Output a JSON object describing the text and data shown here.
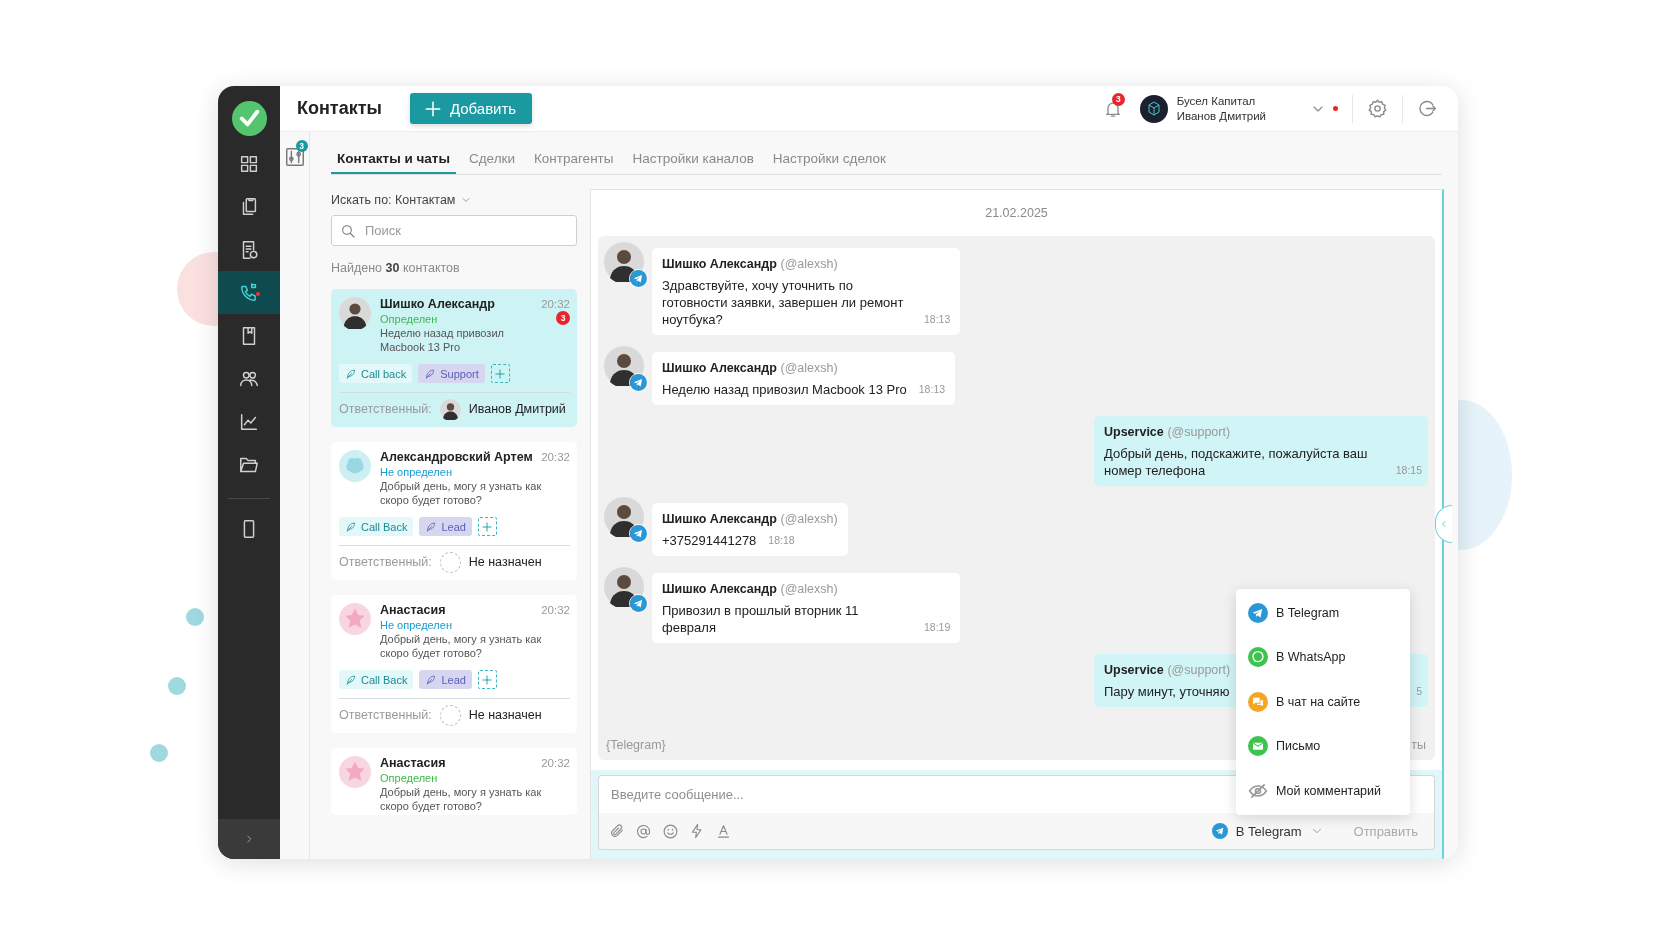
{
  "sidebar": {
    "main_items": [
      {
        "kind": "grid",
        "selected": false,
        "alert": false
      },
      {
        "kind": "copies",
        "selected": false,
        "alert": false
      },
      {
        "kind": "document",
        "selected": false,
        "alert": false
      },
      {
        "kind": "phone",
        "selected": true,
        "alert": true
      },
      {
        "kind": "book",
        "selected": false,
        "alert": false
      },
      {
        "kind": "people",
        "selected": false,
        "alert": false
      },
      {
        "kind": "chart",
        "selected": false,
        "alert": false
      },
      {
        "kind": "folder",
        "selected": false,
        "alert": false
      }
    ],
    "bottom_items": [
      {
        "kind": "mobile",
        "selected": false,
        "alert": false
      }
    ]
  },
  "header": {
    "title": "Контакты",
    "add_button": "Добавить",
    "notification_count": "3",
    "account": {
      "company": "Бусел Капитал",
      "user": "Иванов Дмитрий",
      "online": true
    }
  },
  "filter_badge": "3",
  "tabs": [
    {
      "label": "Контакты и чаты",
      "selected": true
    },
    {
      "label": "Сделки",
      "selected": false
    },
    {
      "label": "Контрагенты",
      "selected": false
    },
    {
      "label": "Настройки каналов",
      "selected": false
    },
    {
      "label": "Настройки сделок",
      "selected": false
    }
  ],
  "search": {
    "label": "Искать по: Контактам",
    "placeholder": "Поиск"
  },
  "found": "Найдено **30** контактов",
  "contacts": [
    {
      "name": "Шишко Александр",
      "time": "20:32",
      "avatar": {
        "kind": "photo"
      },
      "status": {
        "text": "Определен",
        "kind": "identified"
      },
      "message": "Неделю назад привозил Macbook 13 Pro",
      "unread": "3",
      "selected": true,
      "tags": [
        {
          "label": "Call back",
          "kind": "callback"
        },
        {
          "label": "Support",
          "kind": "category"
        }
      ],
      "responsible": {
        "label": "Ответственный:",
        "name": "Иванов Дмитрий",
        "assigned": true
      }
    },
    {
      "name": "Александровский Артем",
      "time": "20:32",
      "avatar": {
        "kind": "blob"
      },
      "status": {
        "text": "Не определен",
        "kind": "unidentified"
      },
      "message": "Добрый день, могу я узнать как скоро будет готово?",
      "selected": false,
      "tags": [
        {
          "label": "Call Back",
          "kind": "callback"
        },
        {
          "label": "Lead",
          "kind": "category"
        }
      ],
      "responsible": {
        "label": "Ответственный:",
        "name": "Не назначен",
        "assigned": false
      }
    },
    {
      "name": "Анастасия",
      "time": "20:32",
      "avatar": {
        "kind": "star"
      },
      "status": {
        "text": "Не определен",
        "kind": "unidentified"
      },
      "message": "Добрый день, могу я узнать как скоро будет готово?",
      "selected": false,
      "tags": [
        {
          "label": "Call Back",
          "kind": "callback"
        },
        {
          "label": "Lead",
          "kind": "category"
        }
      ],
      "responsible": {
        "label": "Ответственный:",
        "name": "Не назначен",
        "assigned": false
      }
    },
    {
      "name": "Анастасия",
      "time": "20:32",
      "avatar": {
        "kind": "star"
      },
      "status": {
        "text": "Определен",
        "kind": "identified"
      },
      "message": "Добрый день, могу я узнать как скоро будет готово?",
      "selected": false
    }
  ],
  "chat": {
    "date": "21.02.2025",
    "messages": [
      {
        "kind": "incoming",
        "author": "Шишко Александр",
        "handle": "(@alexsh)",
        "text": "Здравствуйте, хочу уточнить по готовности заявки, завершен ли ремонт ноутбука?",
        "time": "18:13"
      },
      {
        "kind": "incoming",
        "author": "Шишко Александр",
        "handle": "(@alexsh)",
        "text": "Неделю назад привозил Macbook 13 Pro",
        "time": "18:13"
      },
      {
        "kind": "outgoing",
        "author": "Upservice",
        "handle": "(@support)",
        "text": "Добрый день, подскажите, пожалуйста ваш номер телефона",
        "time": "18:15"
      },
      {
        "kind": "incoming",
        "author": "Шишко Александр",
        "handle": "(@alexsh)",
        "text": "+375291441278",
        "time": "18:18"
      },
      {
        "kind": "incoming",
        "author": "Шишко Александр",
        "handle": "(@alexsh)",
        "text": "Привозил в прошлый вторник 11 февраля",
        "time": "18:19"
      },
      {
        "kind": "outgoing",
        "author": "Upservice",
        "handle": "(@support)",
        "text": "Пару минут, уточняю",
        "time": "5"
      }
    ],
    "channel_tag": "{Telegram}",
    "footer_note": "ты",
    "composer": {
      "placeholder": "Введите сообщение...",
      "channel": "В Telegram",
      "send": "Отправить",
      "send_disabled": true
    }
  },
  "channel_menu": [
    {
      "label": "В Telegram",
      "kind": "telegram"
    },
    {
      "label": "В WhatsApp",
      "kind": "whatsapp"
    },
    {
      "label": "В чат на сайте",
      "kind": "site"
    },
    {
      "label": "Письмо",
      "kind": "email"
    },
    {
      "label": "Мой комментарий",
      "kind": "comment"
    }
  ]
}
